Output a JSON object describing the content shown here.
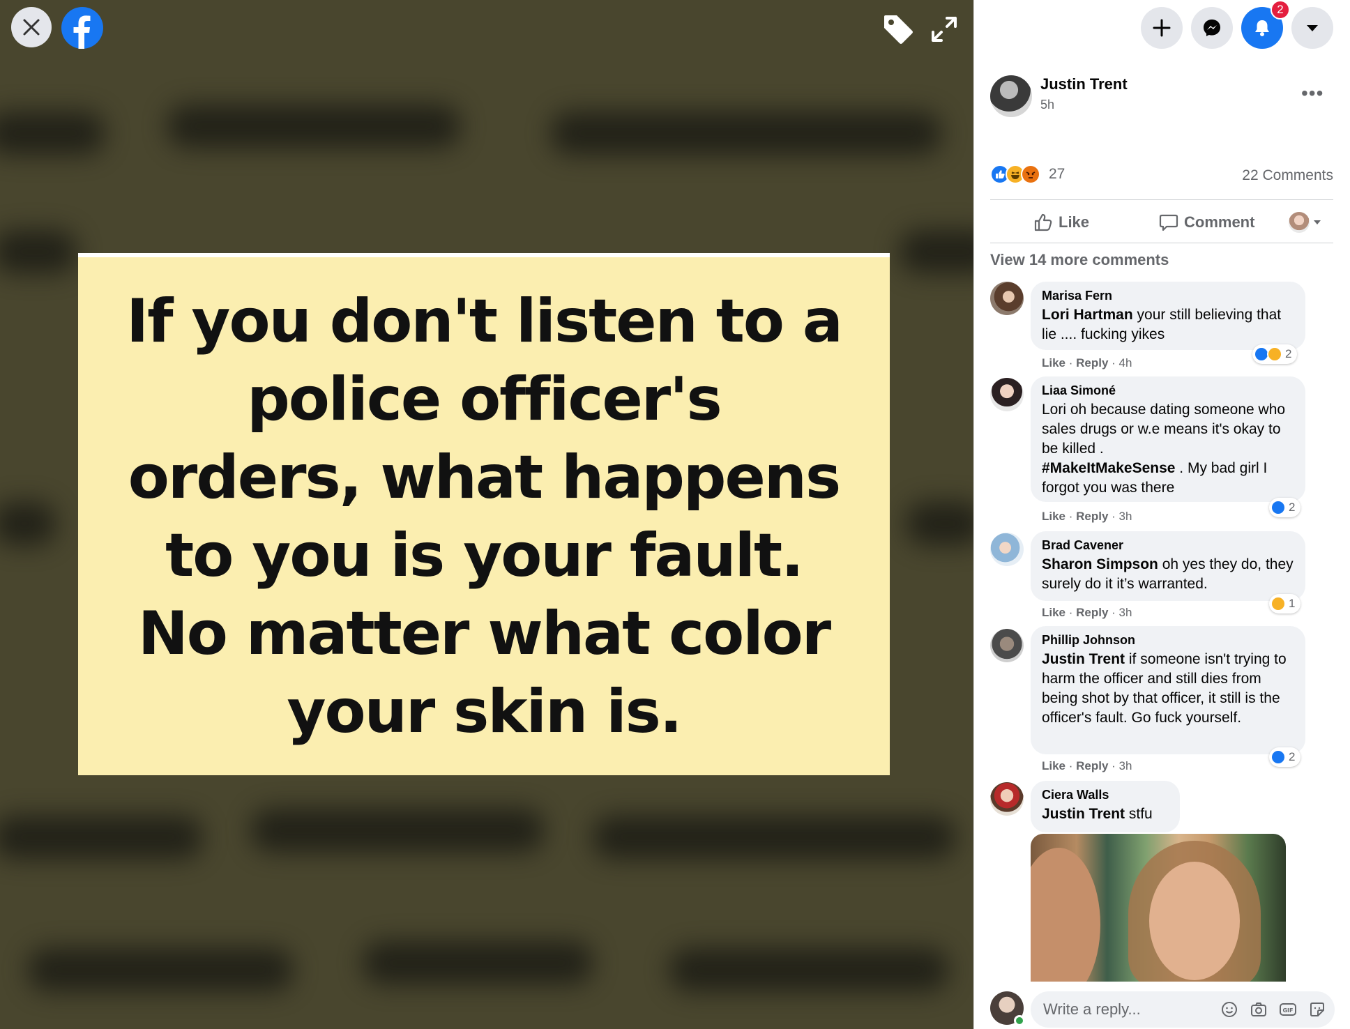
{
  "viewer": {
    "photo_text": "If you don't listen to a\npolice officer's\norders, what happens\nto you is your fault.\nNo matter what color\nyour skin is.",
    "icons": [
      "close-icon",
      "facebook-logo",
      "tag-icon",
      "expand-icon"
    ]
  },
  "topbar": {
    "notification_count": "2",
    "icons": [
      "plus-icon",
      "messenger-icon",
      "bell-icon",
      "caret-down-icon"
    ]
  },
  "post": {
    "author": "Justin Trent",
    "time": "5h",
    "more_icon": "•••",
    "reaction_count": "27",
    "comment_count": "22 Comments",
    "actions": {
      "like": "Like",
      "comment": "Comment"
    }
  },
  "comments": {
    "view_more": "View 14 more comments",
    "items": [
      {
        "author": "Marisa Fern",
        "mention": "Lori Hartman",
        "text": " your still believing that lie .... fucking yikes",
        "like": "Like",
        "reply": "Reply",
        "time": "4h",
        "reactions": "2"
      },
      {
        "author": "Liaa Simoné",
        "text1": "Lori oh because dating someone who sales drugs or w.e means it's okay to be killed .",
        "hashtag": "#MakeItMakeSense",
        "text2": " . My bad girl I forgot you was there",
        "like": "Like",
        "reply": "Reply",
        "time": "3h",
        "reactions": "2"
      },
      {
        "author": "Brad Cavener",
        "mention": "Sharon Simpson",
        "text": " oh yes they do, they surely do it it’s warranted.",
        "like": "Like",
        "reply": "Reply",
        "time": "3h",
        "reactions": "1"
      },
      {
        "author": "Phillip Johnson",
        "mention": "Justin Trent",
        "text": " if someone isn't trying to harm the officer and still dies from being shot by that officer, it still is the officer's fault. Go fuck yourself.",
        "like": "Like",
        "reply": "Reply",
        "time": "3h",
        "reactions": "2"
      },
      {
        "author": "Ciera Walls",
        "mention": "Justin Trent",
        "text": " stfu"
      }
    ]
  },
  "reply": {
    "placeholder": "Write a reply...",
    "icons": [
      "emoji-icon",
      "camera-icon",
      "gif-icon",
      "sticker-icon"
    ]
  },
  "colors": {
    "accent": "#1877f2",
    "badge": "#e41e3f",
    "photo_bg": "#fbeeb0"
  }
}
